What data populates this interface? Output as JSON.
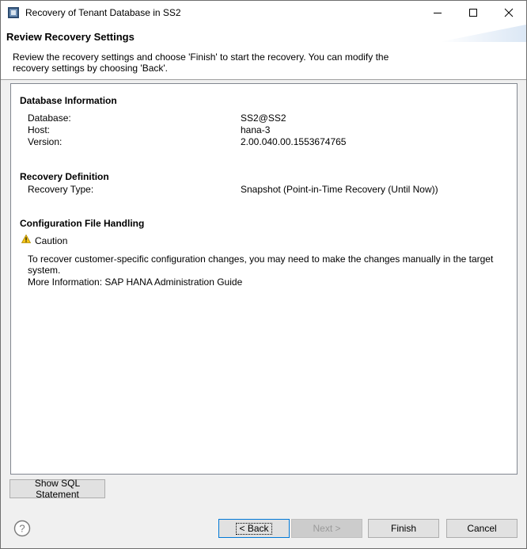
{
  "window": {
    "title": "Recovery of Tenant Database in SS2",
    "icon": "hana-studio-icon"
  },
  "banner": {
    "title": "Review Recovery Settings",
    "description": "Review the recovery settings and choose 'Finish' to start the recovery. You can modify the recovery settings by choosing 'Back'."
  },
  "database_info": {
    "heading": "Database Information",
    "rows": [
      {
        "label": "Database:",
        "value": "SS2@SS2"
      },
      {
        "label": "Host:",
        "value": "hana-3"
      },
      {
        "label": "Version:",
        "value": "2.00.040.00.1553674765"
      }
    ]
  },
  "recovery_definition": {
    "heading": "Recovery Definition",
    "label": "Recovery Type:",
    "value": "Snapshot (Point-in-Time Recovery (Until Now))"
  },
  "config_handling": {
    "heading": "Configuration File Handling",
    "caution_label": "Caution",
    "note": "To recover customer-specific configuration changes, you may need to make the changes manually in the target system.",
    "more_info": "More Information: SAP HANA Administration Guide"
  },
  "buttons": {
    "show_sql": "Show SQL Statement",
    "back": "< Back",
    "next": "Next >",
    "finish": "Finish",
    "cancel": "Cancel"
  },
  "colors": {
    "accent": "#0078d7",
    "warning": "#f5c518"
  }
}
